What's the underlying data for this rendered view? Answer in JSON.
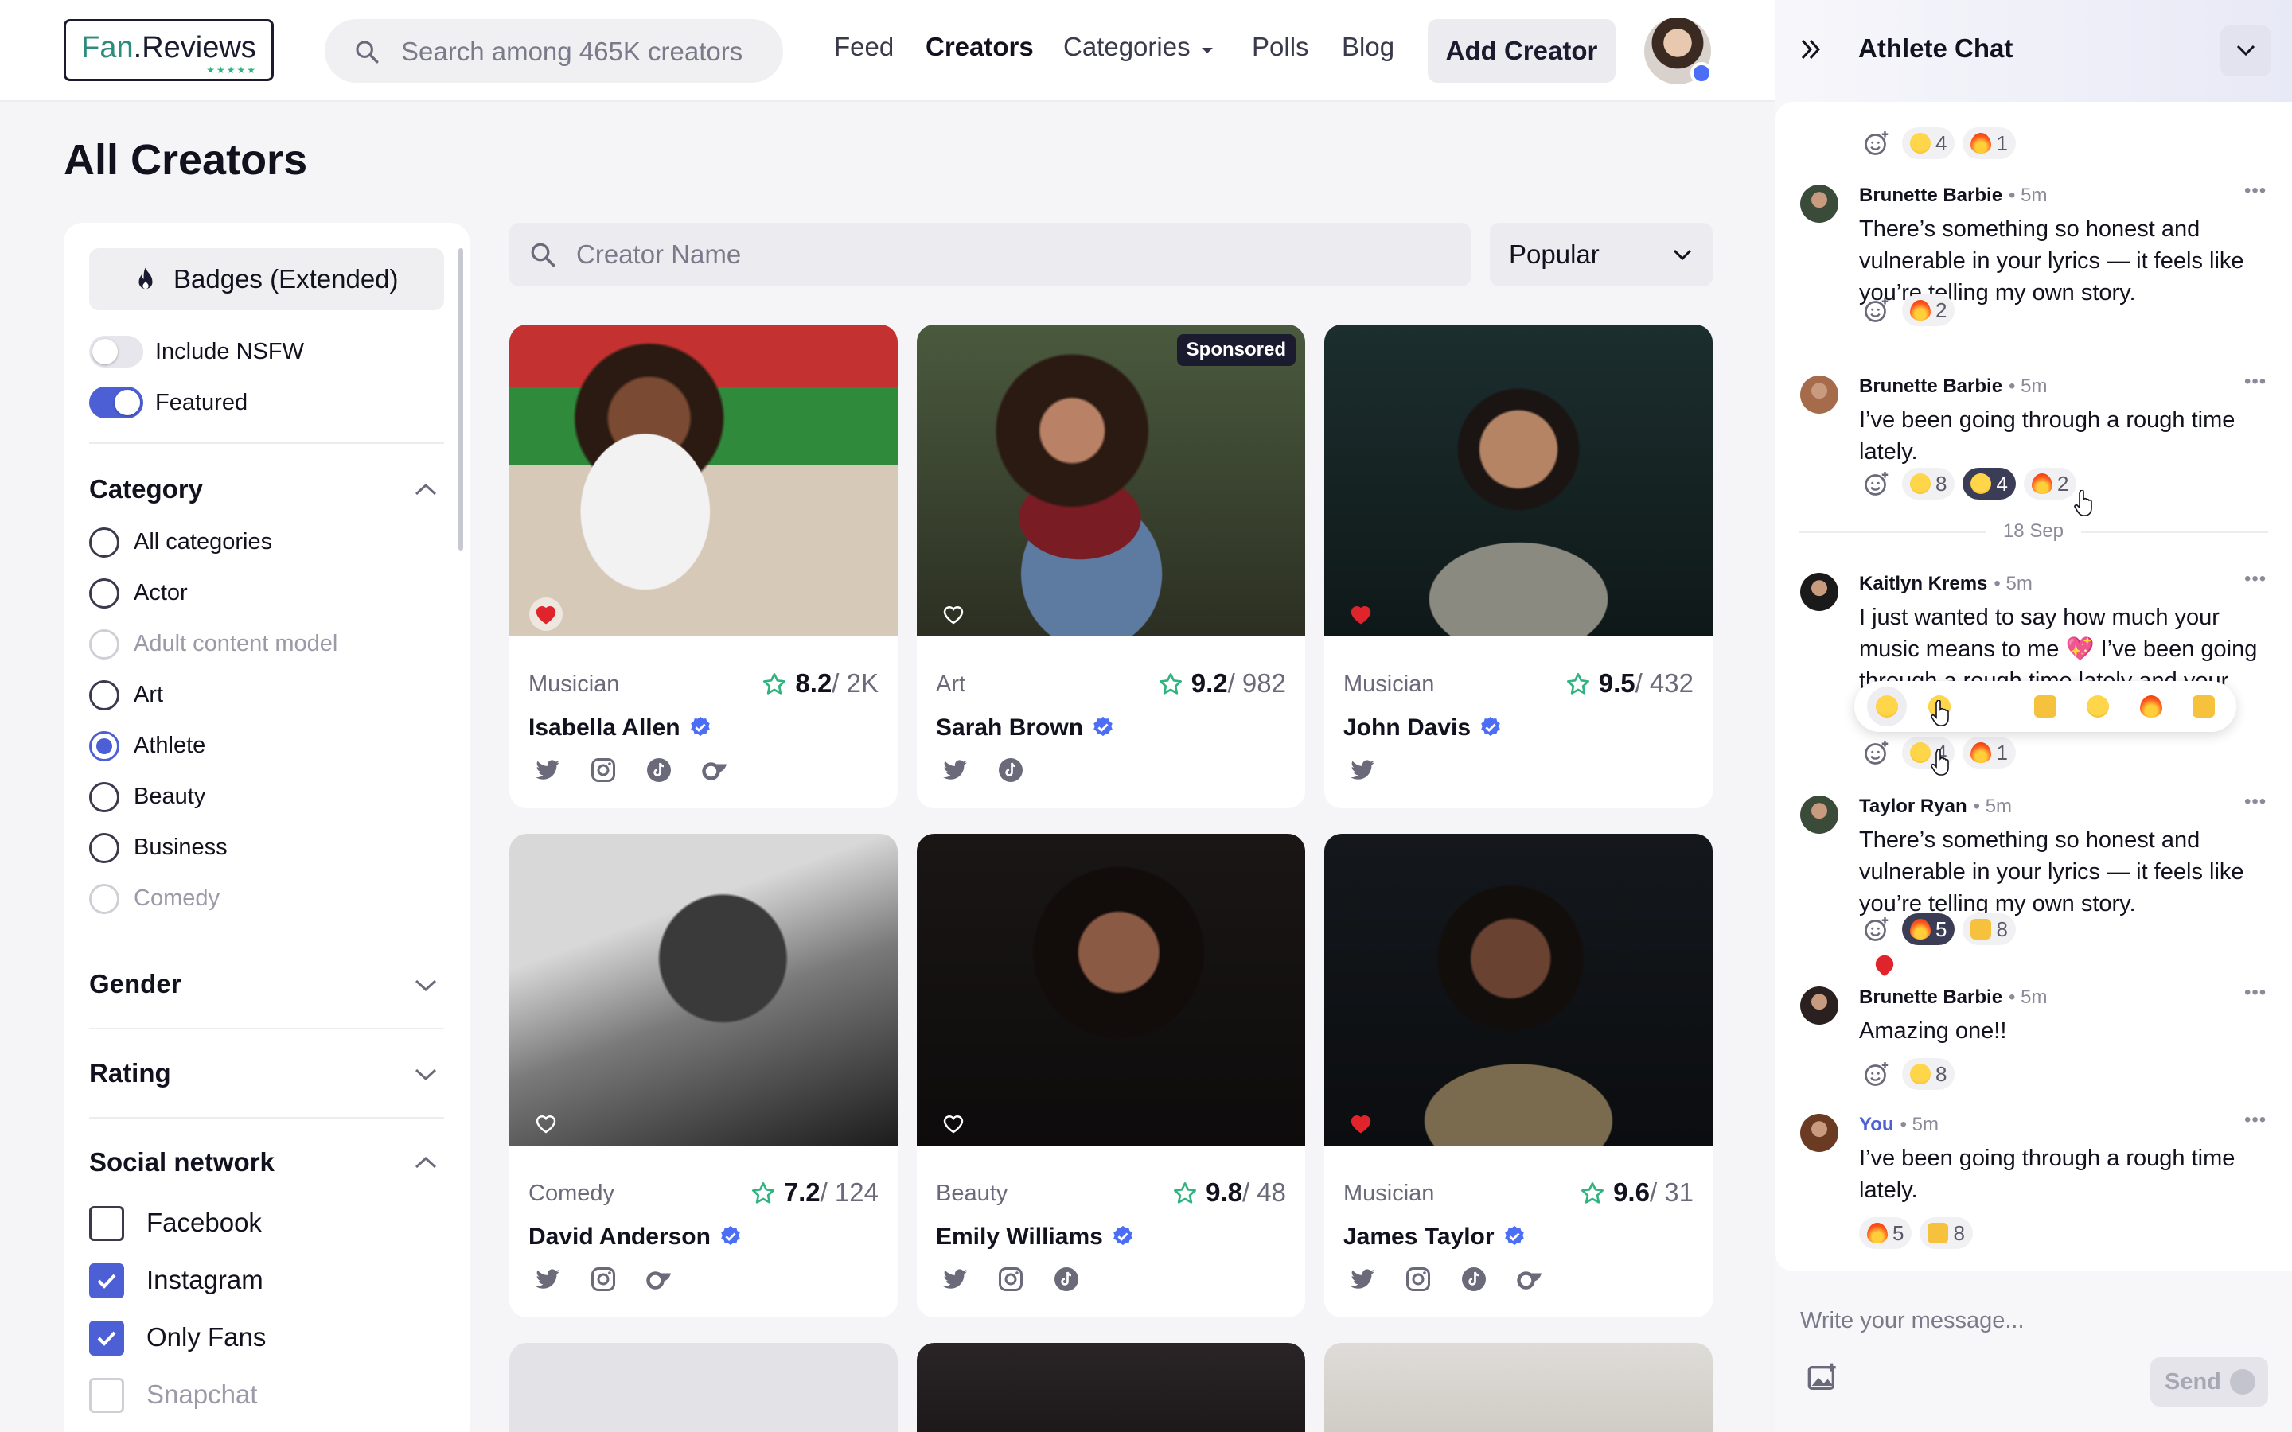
{
  "header": {
    "logo_text_a": "Fan",
    "logo_text_b": ".Reviews",
    "logo_stars": "★★★★★",
    "search_placeholder": "Search among 465K creators",
    "nav": {
      "feed": "Feed",
      "creators": "Creators",
      "categories": "Categories",
      "polls": "Polls",
      "blog": "Blog"
    },
    "add_creator": "Add Creator"
  },
  "page_title": "All Creators",
  "sidebar": {
    "badges_button": "Badges (Extended)",
    "toggles": {
      "nsfw": {
        "label": "Include NSFW",
        "on": false
      },
      "featured": {
        "label": "Featured",
        "on": true
      }
    },
    "category": {
      "title": "Category",
      "options": [
        "All categories",
        "Actor",
        "Adult content model",
        "Art",
        "Athlete",
        "Beauty",
        "Business",
        "Comedy"
      ],
      "selected": "Athlete"
    },
    "gender_title": "Gender",
    "rating_title": "Rating",
    "social": {
      "title": "Social network",
      "options": [
        "Facebook",
        "Instagram",
        "Only Fans",
        "Snapchat"
      ],
      "checked": [
        "Instagram",
        "Only Fans"
      ]
    }
  },
  "toolbar": {
    "name_placeholder": "Creator Name",
    "sort_value": "Popular"
  },
  "cards": [
    {
      "category": "Musician",
      "score": "8.2",
      "count": "/ 2K",
      "name": "Isabella Allen",
      "favorite": true,
      "sponsored": false,
      "socials": [
        "twitter",
        "instagram",
        "tiktok",
        "onlyfans"
      ]
    },
    {
      "category": "Art",
      "score": "9.2",
      "count": "/ 982",
      "name": "Sarah Brown",
      "favorite": false,
      "sponsored": true,
      "sponsored_label": "Sponsored",
      "socials": [
        "twitter",
        "tiktok"
      ]
    },
    {
      "category": "Musician",
      "score": "9.5",
      "count": "/ 432",
      "name": "John Davis",
      "favorite": true,
      "sponsored": false,
      "socials": [
        "twitter"
      ]
    },
    {
      "category": "Comedy",
      "score": "7.2",
      "count": "/ 124",
      "name": "David Anderson",
      "favorite": false,
      "sponsored": false,
      "socials": [
        "twitter",
        "instagram",
        "onlyfans"
      ]
    },
    {
      "category": "Beauty",
      "score": "9.8",
      "count": "/ 48",
      "name": "Emily Williams",
      "favorite": false,
      "sponsored": false,
      "socials": [
        "twitter",
        "instagram",
        "tiktok"
      ]
    },
    {
      "category": "Musician",
      "score": "9.6",
      "count": "/ 31",
      "name": "James Taylor",
      "favorite": true,
      "sponsored": false,
      "socials": [
        "twitter",
        "instagram",
        "tiktok",
        "onlyfans"
      ]
    }
  ],
  "chat": {
    "title": "Athlete Chat",
    "top_reactions": [
      {
        "emoji": "laugh",
        "count": "4"
      },
      {
        "emoji": "fire",
        "count": "1"
      }
    ],
    "messages": [
      {
        "author": "Brunette Barbie",
        "time": "5m",
        "text": "There’s something so honest and vulnerable in your lyrics — it feels like you’re telling my own story.",
        "reactions": [
          {
            "emoji": "fire",
            "count": "2"
          }
        ]
      },
      {
        "author": "Brunette Barbie",
        "time": "5m",
        "text": "I’ve been going through a rough time lately.",
        "reactions": [
          {
            "emoji": "laugh",
            "count": "8"
          },
          {
            "emoji": "star",
            "count": "4",
            "mine": true
          },
          {
            "emoji": "fire",
            "count": "2"
          }
        ]
      },
      {
        "author": "Kaitlyn Krems",
        "time": "5m",
        "text": "I just wanted to say how much your music means to me 💖 I’ve been going through a rough time lately and your music got me through it. I just know.",
        "reactions": [
          {
            "emoji": "laugh",
            "count": "4"
          },
          {
            "emoji": "fire",
            "count": "1"
          }
        ]
      },
      {
        "author": "Taylor Ryan",
        "time": "5m",
        "text": "There’s something so honest and vulnerable in your lyrics — it feels like you’re telling my own story.",
        "reactions": [
          {
            "emoji": "fire",
            "count": "5",
            "mine": true
          },
          {
            "emoji": "thumb",
            "count": "8"
          }
        ]
      },
      {
        "author": "Brunette Barbie",
        "time": "5m",
        "text": "Amazing one!!",
        "reactions": [
          {
            "emoji": "laugh",
            "count": "8"
          }
        ]
      },
      {
        "author": "You",
        "time": "5m",
        "text": "I’ve been going through a rough time lately.",
        "reactions": [
          {
            "emoji": "fire",
            "count": "5"
          },
          {
            "emoji": "thumb",
            "count": "8"
          }
        ]
      }
    ],
    "date_separator": "18 Sep",
    "picker": [
      "laugh",
      "grin",
      "heart",
      "thumb-up",
      "star-struck",
      "fire",
      "thumb-down"
    ],
    "input_placeholder": "Write your message...",
    "send_label": "Send"
  },
  "colors": {
    "accent": "#4c5fd5",
    "star": "#2fb37f",
    "heart": "#e0242c",
    "text": "#12121f"
  }
}
